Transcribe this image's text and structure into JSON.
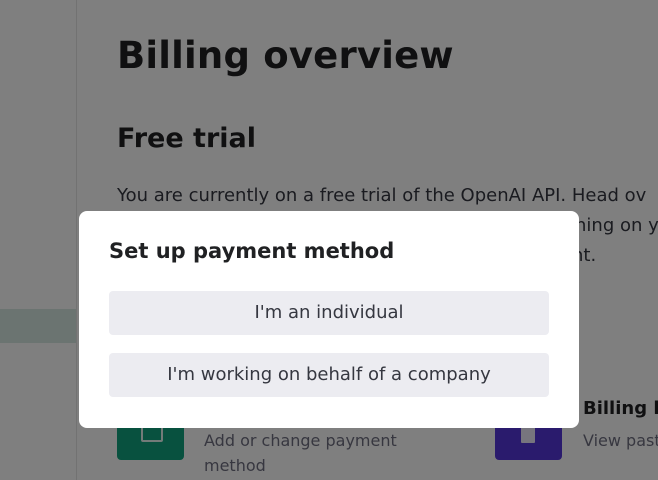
{
  "page": {
    "title": "Billing overview",
    "section": {
      "title": "Free trial",
      "text_lines": [
        "You are currently on a free trial of the OpenAI API. Head ov",
        "                                                    ning on y",
        "                                                   nt."
      ]
    },
    "cards": [
      {
        "icon": "payment-card-icon",
        "color": "#10a37f",
        "title": "",
        "desc_lines": [
          "Add or change payment",
          "method"
        ]
      },
      {
        "icon": "billing-history-icon",
        "color": "#5436da",
        "title": "Billing h",
        "desc": "View past"
      }
    ]
  },
  "modal": {
    "title": "Set up payment method",
    "buttons": {
      "individual": "I'm an individual",
      "company": "I'm working on behalf of a company"
    }
  },
  "colors": {
    "overlay": "rgba(0,0,0,0.5)",
    "button_bg": "#ececf1",
    "sidebar_active": "#d6e8e2"
  }
}
